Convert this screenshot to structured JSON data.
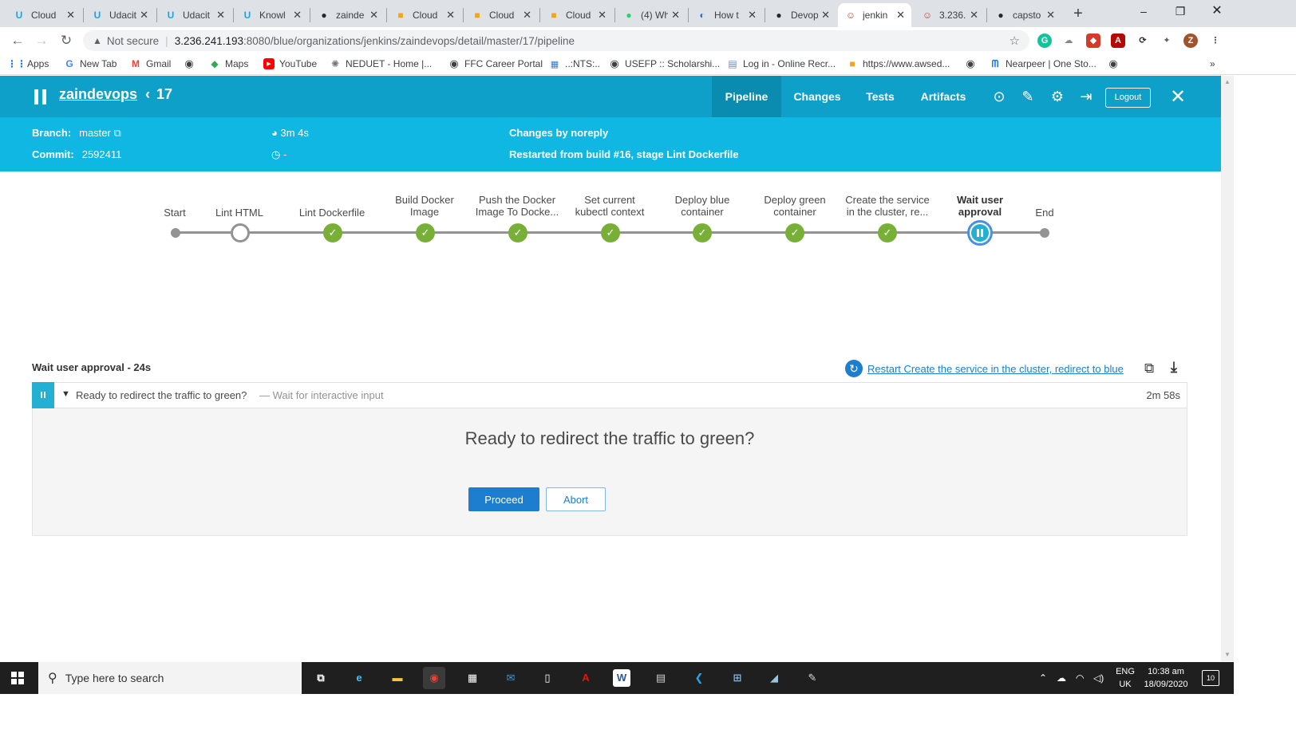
{
  "browser": {
    "tabs": [
      {
        "label": "Cloud",
        "icon": "udacity-icon",
        "active": false
      },
      {
        "label": "Udacit",
        "icon": "udacity-icon",
        "active": false
      },
      {
        "label": "Udacit",
        "icon": "udacity-icon",
        "active": false
      },
      {
        "label": "Knowl",
        "icon": "udacity-icon",
        "active": false
      },
      {
        "label": "zainde",
        "icon": "github-icon",
        "active": false
      },
      {
        "label": "Cloud",
        "icon": "aws-icon",
        "active": false
      },
      {
        "label": "Cloud",
        "icon": "aws-icon",
        "active": false
      },
      {
        "label": "Cloud",
        "icon": "aws-icon",
        "active": false
      },
      {
        "label": "(4) Wh",
        "icon": "whatsapp-icon",
        "active": false
      },
      {
        "label": "How t",
        "icon": "devops-icon",
        "active": false
      },
      {
        "label": "Devop",
        "icon": "github-icon",
        "active": false
      },
      {
        "label": "jenkin",
        "icon": "jenkins-icon",
        "active": true
      },
      {
        "label": "3.236.",
        "icon": "jenkins-icon",
        "active": false
      },
      {
        "label": "capsto",
        "icon": "github-icon",
        "active": false
      }
    ],
    "new_tab": "+",
    "address": {
      "security_label": "Not secure",
      "host": "3.236.241.193",
      "path": ":8080/blue/organizations/jenkins/zaindevops/detail/master/17/pipeline"
    },
    "bookmarks": [
      {
        "label": "Apps",
        "icon": "apps-grid-icon"
      },
      {
        "label": "New Tab",
        "icon": "google-icon"
      },
      {
        "label": "Gmail",
        "icon": "gmail-icon"
      },
      {
        "label": "",
        "icon": "globe-icon"
      },
      {
        "label": "Maps",
        "icon": "maps-icon"
      },
      {
        "label": "YouTube",
        "icon": "youtube-icon"
      },
      {
        "label": "NEDUET - Home |...",
        "icon": "ned-icon"
      },
      {
        "label": "FFC Career Portal",
        "icon": "globe-icon"
      },
      {
        "label": "..:NTS:..",
        "icon": "nts-icon"
      },
      {
        "label": "USEFP :: Scholarshi...",
        "icon": "globe-icon"
      },
      {
        "label": "Log in - Online Recr...",
        "icon": "doc-icon"
      },
      {
        "label": "https://www.awsed...",
        "icon": "aws-icon"
      },
      {
        "label": "",
        "icon": "globe-icon"
      },
      {
        "label": "Nearpeer | One Sto...",
        "icon": "nearpeer-icon"
      },
      {
        "label": "",
        "icon": "globe-icon"
      }
    ],
    "bookmarks_more": "»"
  },
  "header": {
    "project": "zaindevops",
    "run_number": "17",
    "tabs": [
      {
        "label": "Pipeline",
        "active": true
      },
      {
        "label": "Changes",
        "active": false
      },
      {
        "label": "Tests",
        "active": false
      },
      {
        "label": "Artifacts",
        "active": false
      }
    ],
    "logout_label": "Logout"
  },
  "run_info": {
    "branch_label": "Branch:",
    "branch_value": "master",
    "commit_label": "Commit:",
    "commit_value": "2592411",
    "duration": "3m 4s",
    "finished": "-",
    "changes": "Changes by noreply",
    "cause": "Restarted from build #16, stage Lint Dockerfile"
  },
  "pipeline": {
    "stages": [
      {
        "label": "Start",
        "status": "start"
      },
      {
        "label": "Lint HTML",
        "status": "not_built"
      },
      {
        "label": "Lint Dockerfile",
        "status": "success"
      },
      {
        "label": "Build Docker Image",
        "status": "success"
      },
      {
        "label": "Push the Docker Image To Docke...",
        "status": "success"
      },
      {
        "label": "Set current kubectl context",
        "status": "success"
      },
      {
        "label": "Deploy blue container",
        "status": "success"
      },
      {
        "label": "Deploy green container",
        "status": "success"
      },
      {
        "label": "Create the service in the cluster, re...",
        "status": "success"
      },
      {
        "label": "Wait user approval",
        "status": "paused",
        "selected": true
      },
      {
        "label": "End",
        "status": "end"
      }
    ]
  },
  "step_detail": {
    "title": "Wait user approval - 24s",
    "restart_link": "Restart Create the service in the cluster, redirect to blue",
    "step_text": "Ready to redirect the traffic to green?",
    "step_desc": "— Wait for interactive input",
    "step_duration": "2m 58s",
    "question": "Ready to redirect the traffic to green?",
    "proceed_label": "Proceed",
    "abort_label": "Abort"
  },
  "taskbar": {
    "search_placeholder": "Type here to search",
    "language": "ENG",
    "region": "UK",
    "time": "10:38 am",
    "date": "18/09/2020",
    "notifications": "10"
  },
  "colors": {
    "header_bg": "#0fa0c9",
    "subheader_bg": "#10b7e3",
    "success": "#78b037",
    "paused": "#24b0d5",
    "proceed": "#1d7dcf"
  }
}
